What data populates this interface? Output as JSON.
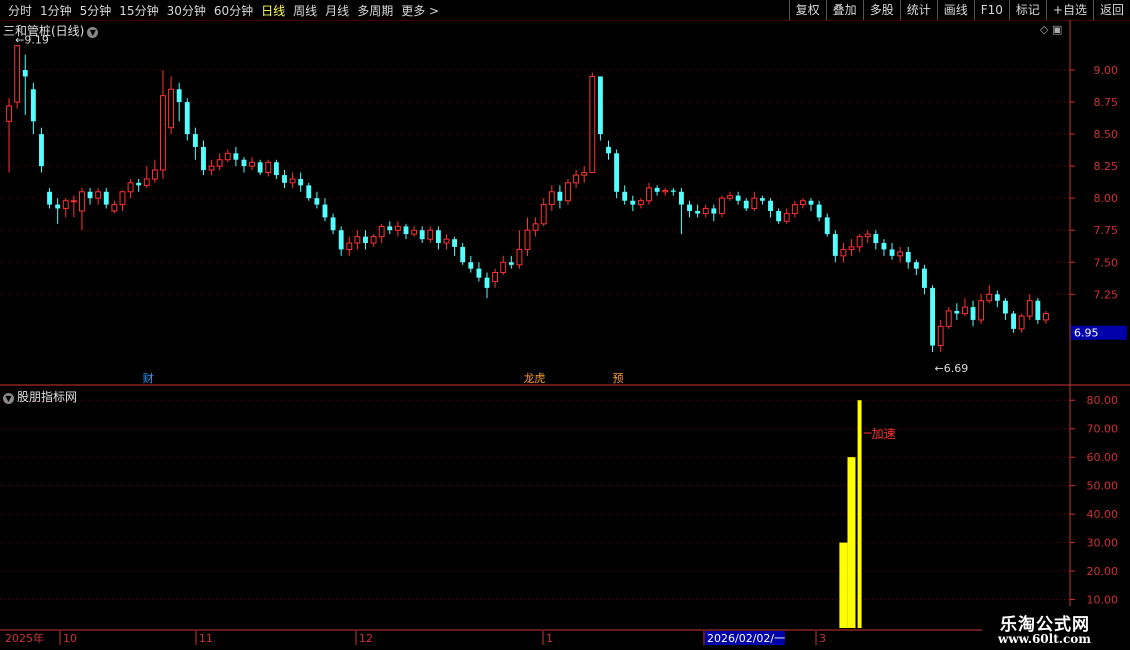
{
  "toolbar": {
    "periods": [
      "分时",
      "1分钟",
      "5分钟",
      "15分钟",
      "30分钟",
      "60分钟",
      "日线",
      "周线",
      "月线",
      "多周期",
      "更多 >"
    ],
    "active_period": "日线",
    "right_buttons": [
      "复权",
      "叠加",
      "多股",
      "统计",
      "画线",
      "F10",
      "标记",
      "+自选",
      "返回"
    ]
  },
  "main_chart": {
    "title": "三和管桩(日线)",
    "high_label": "9.19",
    "low_label": "6.69",
    "price_label": "6.95",
    "events": [
      {
        "label": "财",
        "color": "#3399ff"
      },
      {
        "label": "龙虎",
        "color": "#ff9933"
      },
      {
        "label": "预",
        "color": "#ff9933"
      }
    ]
  },
  "sub_chart": {
    "title": "股朋指标网",
    "annotation": "加速"
  },
  "date_axis": {
    "labels": [
      "2025年",
      "10",
      "11",
      "12",
      "1",
      "2026/02/02/一",
      "3"
    ]
  },
  "watermark": {
    "line1": "乐淘公式网",
    "line2": "www.60lt.com"
  },
  "colors": {
    "up": "#ff3333",
    "down": "#54ffff",
    "indicator": "#ffff00",
    "grid": "#6b0000",
    "axis": "#cc3333"
  },
  "chart_data": [
    {
      "type": "candlestick",
      "title": "三和管桩(日线)",
      "y_ticks": [
        9.0,
        8.75,
        8.5,
        8.25,
        8.0,
        7.75,
        7.5,
        7.25
      ],
      "ylim": [
        6.55,
        9.25
      ],
      "highest": 9.19,
      "lowest": 6.69,
      "last_price": 6.95,
      "candles": [
        [
          8.6,
          8.72,
          8.78,
          8.2
        ],
        [
          8.75,
          9.19,
          9.19,
          8.7
        ],
        [
          9.0,
          8.95,
          9.12,
          8.65
        ],
        [
          8.85,
          8.6,
          8.9,
          8.5
        ],
        [
          8.5,
          8.25,
          8.55,
          8.2
        ],
        [
          8.05,
          7.95,
          8.08,
          7.92
        ],
        [
          7.95,
          7.92,
          8.0,
          7.8
        ],
        [
          7.92,
          7.98,
          8.0,
          7.85
        ],
        [
          7.98,
          7.98,
          8.02,
          7.85
        ],
        [
          7.9,
          8.05,
          8.08,
          7.75
        ],
        [
          8.05,
          8.0,
          8.08,
          7.95
        ],
        [
          8.0,
          8.05,
          8.08,
          7.95
        ],
        [
          8.05,
          7.95,
          8.08,
          7.92
        ],
        [
          7.9,
          7.95,
          7.98,
          7.88
        ],
        [
          7.95,
          8.05,
          8.06,
          7.9
        ],
        [
          8.05,
          8.12,
          8.15,
          8.0
        ],
        [
          8.12,
          8.1,
          8.15,
          8.05
        ],
        [
          8.1,
          8.15,
          8.25,
          8.08
        ],
        [
          8.15,
          8.22,
          8.3,
          8.12
        ],
        [
          8.22,
          8.8,
          9.0,
          8.15
        ],
        [
          8.55,
          8.85,
          8.95,
          8.5
        ],
        [
          8.85,
          8.75,
          8.9,
          8.6
        ],
        [
          8.75,
          8.5,
          8.78,
          8.45
        ],
        [
          8.5,
          8.4,
          8.55,
          8.3
        ],
        [
          8.4,
          8.22,
          8.45,
          8.18
        ],
        [
          8.22,
          8.25,
          8.3,
          8.18
        ],
        [
          8.25,
          8.3,
          8.35,
          8.22
        ],
        [
          8.3,
          8.35,
          8.38,
          8.28
        ],
        [
          8.35,
          8.3,
          8.4,
          8.25
        ],
        [
          8.3,
          8.25,
          8.32,
          8.2
        ],
        [
          8.25,
          8.28,
          8.32,
          8.22
        ],
        [
          8.28,
          8.2,
          8.3,
          8.18
        ],
        [
          8.2,
          8.28,
          8.3,
          8.17
        ],
        [
          8.28,
          8.18,
          8.3,
          8.15
        ],
        [
          8.18,
          8.12,
          8.22,
          8.08
        ],
        [
          8.12,
          8.15,
          8.2,
          8.08
        ],
        [
          8.15,
          8.1,
          8.2,
          8.05
        ],
        [
          8.1,
          8.0,
          8.12,
          7.98
        ],
        [
          8.0,
          7.95,
          8.05,
          7.92
        ],
        [
          7.95,
          7.85,
          8.0,
          7.82
        ],
        [
          7.85,
          7.75,
          7.88,
          7.72
        ],
        [
          7.75,
          7.6,
          7.78,
          7.55
        ],
        [
          7.6,
          7.65,
          7.7,
          7.55
        ],
        [
          7.65,
          7.7,
          7.75,
          7.6
        ],
        [
          7.7,
          7.65,
          7.75,
          7.6
        ],
        [
          7.65,
          7.7,
          7.72,
          7.62
        ],
        [
          7.7,
          7.78,
          7.8,
          7.65
        ],
        [
          7.78,
          7.75,
          7.82,
          7.72
        ],
        [
          7.75,
          7.78,
          7.82,
          7.7
        ],
        [
          7.78,
          7.72,
          7.8,
          7.68
        ],
        [
          7.72,
          7.75,
          7.78,
          7.7
        ],
        [
          7.75,
          7.68,
          7.78,
          7.65
        ],
        [
          7.68,
          7.75,
          7.78,
          7.65
        ],
        [
          7.75,
          7.65,
          7.78,
          7.6
        ],
        [
          7.65,
          7.68,
          7.72,
          7.6
        ],
        [
          7.68,
          7.62,
          7.7,
          7.55
        ],
        [
          7.62,
          7.5,
          7.65,
          7.48
        ],
        [
          7.5,
          7.45,
          7.55,
          7.42
        ],
        [
          7.45,
          7.38,
          7.5,
          7.35
        ],
        [
          7.38,
          7.3,
          7.42,
          7.22
        ],
        [
          7.35,
          7.42,
          7.45,
          7.3
        ],
        [
          7.42,
          7.5,
          7.55,
          7.4
        ],
        [
          7.5,
          7.48,
          7.55,
          7.45
        ],
        [
          7.48,
          7.6,
          7.75,
          7.45
        ],
        [
          7.6,
          7.75,
          7.85,
          7.55
        ],
        [
          7.75,
          7.8,
          7.85,
          7.7
        ],
        [
          7.8,
          7.95,
          8.0,
          7.78
        ],
        [
          7.95,
          8.05,
          8.1,
          7.9
        ],
        [
          8.05,
          7.98,
          8.1,
          7.92
        ],
        [
          7.98,
          8.12,
          8.15,
          7.95
        ],
        [
          8.12,
          8.18,
          8.22,
          8.08
        ],
        [
          8.18,
          8.2,
          8.25,
          8.12
        ],
        [
          8.2,
          8.95,
          8.98,
          8.2
        ],
        [
          8.95,
          8.5,
          8.95,
          8.45
        ],
        [
          8.4,
          8.35,
          8.45,
          8.3
        ],
        [
          8.35,
          8.05,
          8.38,
          8.0
        ],
        [
          8.05,
          7.98,
          8.1,
          7.95
        ],
        [
          7.98,
          7.95,
          8.02,
          7.9
        ],
        [
          7.95,
          7.98,
          8.0,
          7.92
        ],
        [
          7.98,
          8.08,
          8.12,
          7.95
        ],
        [
          8.08,
          8.05,
          8.1,
          8.02
        ],
        [
          8.05,
          8.06,
          8.08,
          8.02
        ],
        [
          8.06,
          8.05,
          8.08,
          8.02
        ],
        [
          8.05,
          7.95,
          8.08,
          7.72
        ],
        [
          7.95,
          7.9,
          7.98,
          7.85
        ],
        [
          7.9,
          7.88,
          7.95,
          7.85
        ],
        [
          7.88,
          7.92,
          7.95,
          7.85
        ],
        [
          7.92,
          7.88,
          7.95,
          7.82
        ],
        [
          7.88,
          8.0,
          8.02,
          7.85
        ],
        [
          8.0,
          8.02,
          8.05,
          7.98
        ],
        [
          8.02,
          7.98,
          8.05,
          7.95
        ],
        [
          7.98,
          7.92,
          8.0,
          7.9
        ],
        [
          7.92,
          8.0,
          8.05,
          7.9
        ],
        [
          8.0,
          7.98,
          8.02,
          7.95
        ],
        [
          7.98,
          7.9,
          8.0,
          7.85
        ],
        [
          7.9,
          7.82,
          7.92,
          7.8
        ],
        [
          7.82,
          7.88,
          7.92,
          7.8
        ],
        [
          7.88,
          7.95,
          7.98,
          7.85
        ],
        [
          7.95,
          7.98,
          8.0,
          7.92
        ],
        [
          7.98,
          7.95,
          8.0,
          7.9
        ],
        [
          7.95,
          7.85,
          7.98,
          7.82
        ],
        [
          7.85,
          7.72,
          7.88,
          7.7
        ],
        [
          7.72,
          7.55,
          7.75,
          7.5
        ],
        [
          7.55,
          7.6,
          7.65,
          7.5
        ],
        [
          7.6,
          7.62,
          7.68,
          7.55
        ],
        [
          7.62,
          7.7,
          7.72,
          7.58
        ],
        [
          7.7,
          7.72,
          7.75,
          7.65
        ],
        [
          7.72,
          7.65,
          7.75,
          7.6
        ],
        [
          7.65,
          7.6,
          7.68,
          7.55
        ],
        [
          7.6,
          7.55,
          7.65,
          7.52
        ],
        [
          7.55,
          7.58,
          7.62,
          7.5
        ],
        [
          7.58,
          7.5,
          7.62,
          7.45
        ],
        [
          7.5,
          7.45,
          7.52,
          7.4
        ],
        [
          7.45,
          7.3,
          7.48,
          7.25
        ],
        [
          7.3,
          6.85,
          7.32,
          6.8
        ],
        [
          6.85,
          7.0,
          7.05,
          6.8
        ],
        [
          7.0,
          7.12,
          7.15,
          6.98
        ],
        [
          7.12,
          7.1,
          7.18,
          7.05
        ],
        [
          7.1,
          7.15,
          7.22,
          7.08
        ],
        [
          7.15,
          7.05,
          7.2,
          7.0
        ],
        [
          7.05,
          7.2,
          7.25,
          7.02
        ],
        [
          7.2,
          7.25,
          7.32,
          7.18
        ],
        [
          7.25,
          7.2,
          7.28,
          7.15
        ],
        [
          7.2,
          7.1,
          7.22,
          7.05
        ],
        [
          7.1,
          6.98,
          7.12,
          6.95
        ],
        [
          6.98,
          7.08,
          7.1,
          6.95
        ],
        [
          7.08,
          7.2,
          7.25,
          7.05
        ],
        [
          7.2,
          7.05,
          7.22,
          7.02
        ],
        [
          7.05,
          7.1,
          7.12,
          7.02
        ]
      ]
    },
    {
      "type": "bar",
      "title": "股朋指标网",
      "y_ticks": [
        80.0,
        70.0,
        60.0,
        50.0,
        40.0,
        30.0,
        20.0,
        10.0
      ],
      "ylim": [
        0,
        85
      ],
      "bars": [
        {
          "index": 103,
          "value": 30
        },
        {
          "index": 104,
          "value": 60
        },
        {
          "index": 105,
          "value": 80
        }
      ],
      "annotation": "加速"
    }
  ]
}
